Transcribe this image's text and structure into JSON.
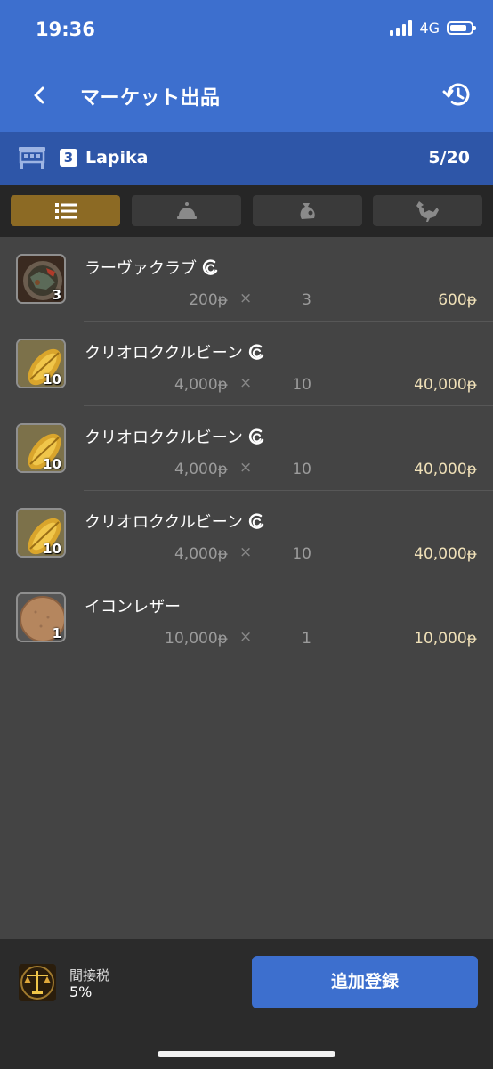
{
  "status": {
    "time": "19:36",
    "network": "4G"
  },
  "nav": {
    "title": "マーケット出品"
  },
  "retainer": {
    "number": "3",
    "name": "Lapika",
    "count": "5/20"
  },
  "tabs": [
    {
      "icon": "list-icon",
      "active": true
    },
    {
      "icon": "bell-icon",
      "active": false
    },
    {
      "icon": "bag-icon",
      "active": false
    },
    {
      "icon": "chocobo-icon",
      "active": false
    }
  ],
  "listings": [
    {
      "name": "ラーヴァクラブ",
      "hq": true,
      "qty": "3",
      "unit_price": "200ᵽ",
      "times": "×",
      "count": "3",
      "total": "600ᵽ",
      "thumb": "food"
    },
    {
      "name": "クリオロククルビーン",
      "hq": true,
      "qty": "10",
      "unit_price": "4,000ᵽ",
      "times": "×",
      "count": "10",
      "total": "40,000ᵽ",
      "thumb": "bean"
    },
    {
      "name": "クリオロククルビーン",
      "hq": true,
      "qty": "10",
      "unit_price": "4,000ᵽ",
      "times": "×",
      "count": "10",
      "total": "40,000ᵽ",
      "thumb": "bean"
    },
    {
      "name": "クリオロククルビーン",
      "hq": true,
      "qty": "10",
      "unit_price": "4,000ᵽ",
      "times": "×",
      "count": "10",
      "total": "40,000ᵽ",
      "thumb": "bean"
    },
    {
      "name": "イコンレザー",
      "hq": false,
      "qty": "1",
      "unit_price": "10,000ᵽ",
      "times": "×",
      "count": "1",
      "total": "10,000ᵽ",
      "thumb": "leather"
    }
  ],
  "footer": {
    "tax_label": "間接税",
    "tax_value": "5%",
    "add_button": "追加登録"
  },
  "colors": {
    "header": "#3d6fce",
    "retainer_bar": "#2e56a8",
    "active_tab": "#8c6a24",
    "total_text": "#efe0b8",
    "background": "#444444"
  }
}
